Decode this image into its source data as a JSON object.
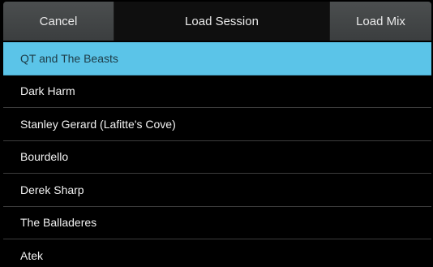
{
  "header": {
    "cancel_label": "Cancel",
    "title": "Load Session",
    "load_mix_label": "Load Mix"
  },
  "sessions": [
    {
      "label": "QT and The Beasts",
      "selected": true
    },
    {
      "label": "Dark Harm"
    },
    {
      "label": "Stanley Gerard (Lafitte's Cove)"
    },
    {
      "label": "Bourdello"
    },
    {
      "label": "Derek Sharp"
    },
    {
      "label": "The Balladeres"
    },
    {
      "label": "Atek"
    }
  ],
  "colors": {
    "selected_row": "#5bc4e8",
    "header_button": "#454849",
    "background": "#000000"
  }
}
